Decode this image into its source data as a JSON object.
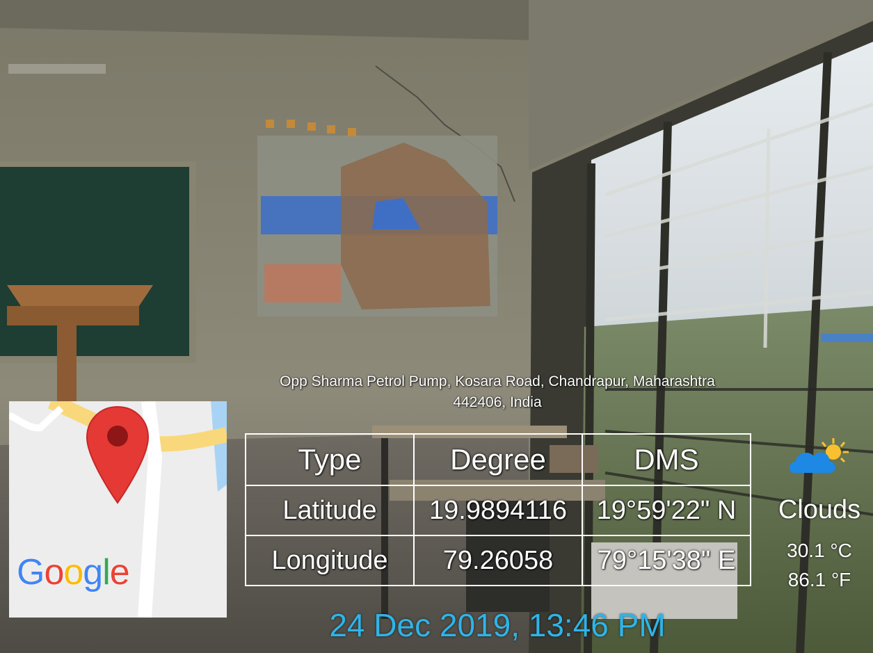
{
  "location": {
    "address_line1": "Opp Sharma Petrol Pump, Kosara Road, Chandrapur, Maharashtra",
    "address_line2": "442406, India"
  },
  "map": {
    "logo_text": "Google",
    "logo_colors": [
      "#4285F4",
      "#EA4335",
      "#FBBC05",
      "#4285F4",
      "#34A853",
      "#EA4335"
    ],
    "pin_color": "#E53935",
    "icon": "map-pin-icon"
  },
  "coordinates": {
    "headers": [
      "Type",
      "Degree",
      "DMS"
    ],
    "rows": [
      [
        "Latitude",
        "19.9894116",
        "19°59'22\" N"
      ],
      [
        "Longitude",
        "79.26058",
        "79°15'38\" E"
      ]
    ]
  },
  "weather": {
    "icon": "cloud-sun-icon",
    "condition": "Clouds",
    "temp_c": "30.1 °C",
    "temp_f": "86.1 °F"
  },
  "timestamp": "24 Dec 2019, 13:46 PM",
  "colors": {
    "timestamp": "#2fb4e8",
    "cloud": "#1e88e5",
    "sun": "#fbc02d"
  }
}
